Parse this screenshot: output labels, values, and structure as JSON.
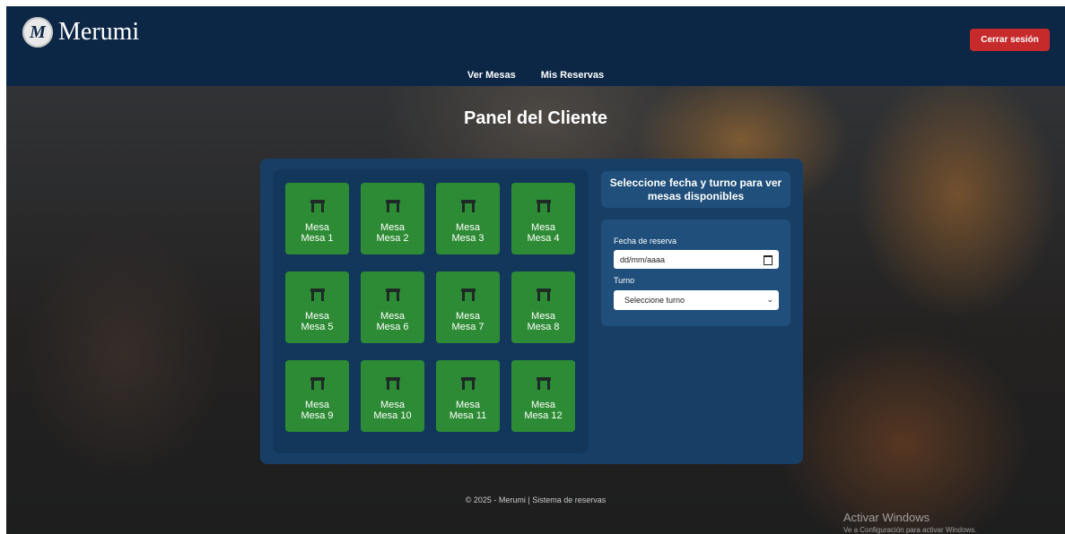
{
  "header": {
    "logo_mark": "M",
    "brand": "Merumi",
    "logout_label": "Cerrar sesión",
    "nav": [
      "Ver Mesas",
      "Mis Reservas"
    ]
  },
  "page_title": "Panel del Cliente",
  "tables": [
    {
      "l1": "Mesa",
      "l2": "Mesa 1"
    },
    {
      "l1": "Mesa",
      "l2": "Mesa 2"
    },
    {
      "l1": "Mesa",
      "l2": "Mesa 3"
    },
    {
      "l1": "Mesa",
      "l2": "Mesa 4"
    },
    {
      "l1": "Mesa",
      "l2": "Mesa 5"
    },
    {
      "l1": "Mesa",
      "l2": "Mesa 6"
    },
    {
      "l1": "Mesa",
      "l2": "Mesa 7"
    },
    {
      "l1": "Mesa",
      "l2": "Mesa 8"
    },
    {
      "l1": "Mesa",
      "l2": "Mesa 9"
    },
    {
      "l1": "Mesa",
      "l2": "Mesa 10"
    },
    {
      "l1": "Mesa",
      "l2": "Mesa 11"
    },
    {
      "l1": "Mesa",
      "l2": "Mesa 12"
    }
  ],
  "side": {
    "heading": "Seleccione fecha y turno para ver mesas disponibles",
    "date_label": "Fecha de reserva",
    "date_placeholder": "dd/mm/aaaa",
    "turn_label": "Turno",
    "turn_selected": "Seleccione turno"
  },
  "footer": "© 2025 - Merumi | Sistema de reservas",
  "watermark": {
    "line1": "Activar Windows",
    "line2": "Ve a Configuración para activar Windows."
  },
  "colors": {
    "header_bg": "#0c2746",
    "table_available": "#2e8b35",
    "logout": "#c62a2a",
    "panel": "#173f66"
  },
  "icons": {
    "table": "table-chair-icon",
    "calendar": "calendar-icon",
    "chevron": "chevron-down-icon"
  }
}
